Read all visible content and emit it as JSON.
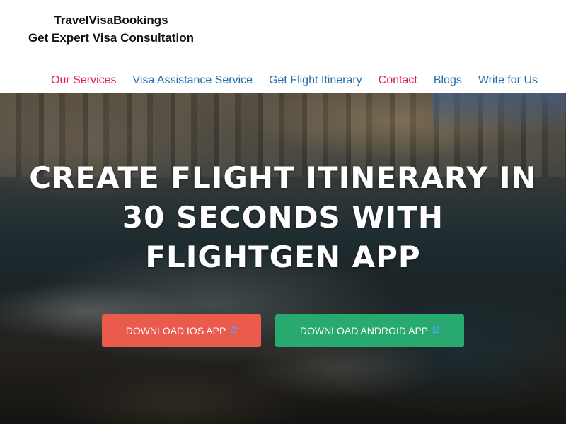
{
  "header": {
    "brand_line1": "TravelVisaBookings",
    "brand_line2": "Get Expert Visa Consultation"
  },
  "nav": {
    "items": [
      {
        "label": "Our Services",
        "color": "#e0195b"
      },
      {
        "label": "Visa Assistance Service",
        "color": "#1f6fae"
      },
      {
        "label": "Get Flight Itinerary",
        "color": "#1f6fae"
      },
      {
        "label": "Contact",
        "color": "#e0195b"
      },
      {
        "label": "Blogs",
        "color": "#1f6fae"
      },
      {
        "label": "Write for Us",
        "color": "#1f6fae"
      }
    ]
  },
  "hero": {
    "headline_line1": "CREATE FLIGHT ITINERARY IN",
    "headline_line2": "30 SECONDS WITH",
    "headline_line3": "FLIGHTGEN APP",
    "ios_button": "DOWNLOAD IOS APP",
    "android_button": "DOWNLOAD ANDROID APP",
    "ios_button_color": "#ea5a4d",
    "android_button_color": "#27a970",
    "button_icon": "external-link-icon"
  }
}
